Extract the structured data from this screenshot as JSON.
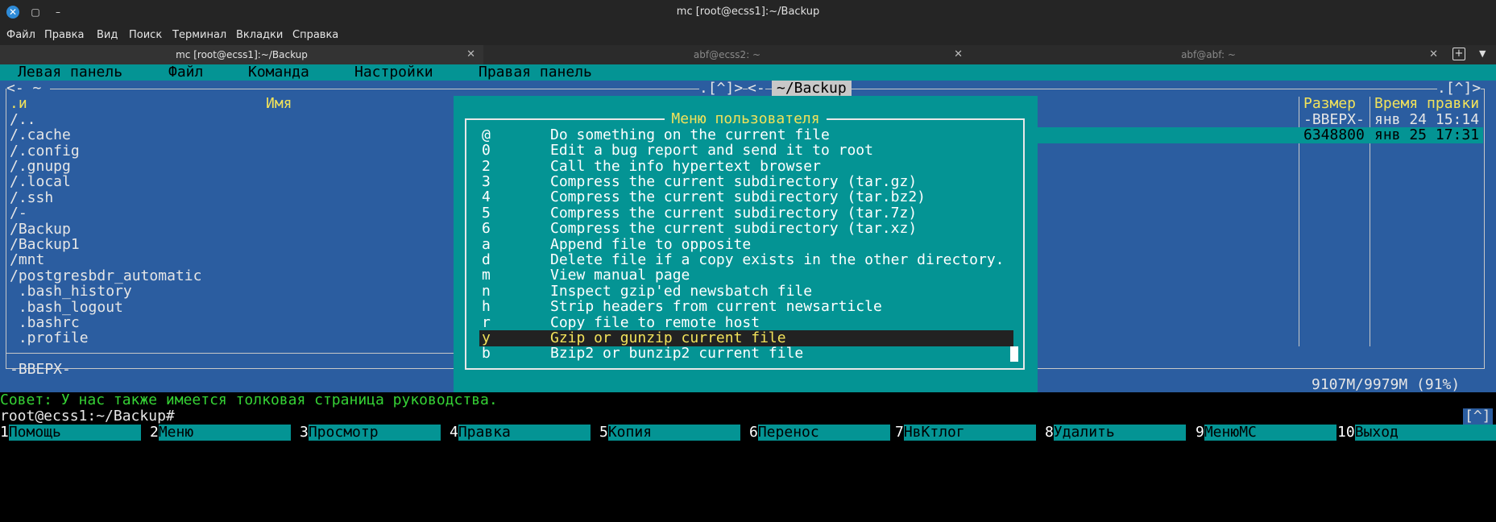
{
  "window": {
    "title": "mc [root@ecss1]:~/Backup"
  },
  "menubar": [
    "Файл",
    "Правка",
    "Вид",
    "Поиск",
    "Терминал",
    "Вкладки",
    "Справка"
  ],
  "tabs": [
    {
      "label": "mc [root@ecss1]:~/Backup",
      "active": true
    },
    {
      "label": "abf@ecss2: ~",
      "active": false
    },
    {
      "label": "abf@abf: ~",
      "active": false
    }
  ],
  "mc": {
    "menu": [
      "Левая панель",
      "Файл",
      "Команда",
      "Настройки",
      "Правая панель"
    ],
    "left_panel": {
      "top_left": "<- ~ ",
      "top_right": ".[^]>",
      "col_left": ".и",
      "col_name": "Имя",
      "entries": [
        "/..",
        "/.cache",
        "/.config",
        "/.gnupg",
        "/.local",
        "/.ssh",
        "/-",
        "/Backup",
        "/Backup1",
        "/mnt",
        "/postgresbdr_automatic",
        " .bash_history",
        " .bash_logout",
        " .bashrc",
        " .profile"
      ],
      "status": "-ВВЕРХ-"
    },
    "right_panel": {
      "top_left": "<-",
      "path": "~/Backup",
      "top_right": ".[^]>",
      "col_size": "Размер",
      "col_time": "Время правки",
      "rows": [
        {
          "size": "-ВВЕРХ-",
          "time": "янв 24 15:14"
        },
        {
          "size": "6348800",
          "time": "янв 25 17:31"
        }
      ],
      "disk": "9107M/9979M (91%)"
    },
    "dialog": {
      "title": "Меню пользователя",
      "items": [
        {
          "key": "@",
          "label": "Do something on the current file"
        },
        {
          "key": "0",
          "label": "Edit a bug report and send it to root"
        },
        {
          "key": "2",
          "label": "Call the info hypertext browser"
        },
        {
          "key": "3",
          "label": "Compress the current subdirectory (tar.gz)"
        },
        {
          "key": "4",
          "label": "Compress the current subdirectory (tar.bz2)"
        },
        {
          "key": "5",
          "label": "Compress the current subdirectory (tar.7z)"
        },
        {
          "key": "6",
          "label": "Compress the current subdirectory (tar.xz)"
        },
        {
          "key": "a",
          "label": "Append file to opposite"
        },
        {
          "key": "d",
          "label": "Delete file if a copy exists in the other directory."
        },
        {
          "key": "m",
          "label": "View manual page"
        },
        {
          "key": "n",
          "label": "Inspect gzip'ed newsbatch file"
        },
        {
          "key": "h",
          "label": "Strip headers from current newsarticle"
        },
        {
          "key": "r",
          "label": "Copy file to remote host"
        },
        {
          "key": "y",
          "label": "Gzip or gunzip current file"
        },
        {
          "key": "b",
          "label": "Bzip2 or bunzip2 current file"
        }
      ],
      "selected_key": "y"
    },
    "hint": "Совет: У нас также имеется толковая страница руководства.",
    "prompt": "root@ecss1:~/Backup#",
    "right_marker": "[^]",
    "fkeys": [
      {
        "n": "1",
        "label": "Помощь"
      },
      {
        "n": "2",
        "label": "Меню"
      },
      {
        "n": "3",
        "label": "Просмотр"
      },
      {
        "n": "4",
        "label": "Правка"
      },
      {
        "n": "5",
        "label": "Копия"
      },
      {
        "n": "6",
        "label": "Перенос"
      },
      {
        "n": "7",
        "label": "НвКтлог"
      },
      {
        "n": "8",
        "label": "Удалить"
      },
      {
        "n": "9",
        "label": "МенюMC"
      },
      {
        "n": "10",
        "label": "Выход"
      }
    ]
  }
}
